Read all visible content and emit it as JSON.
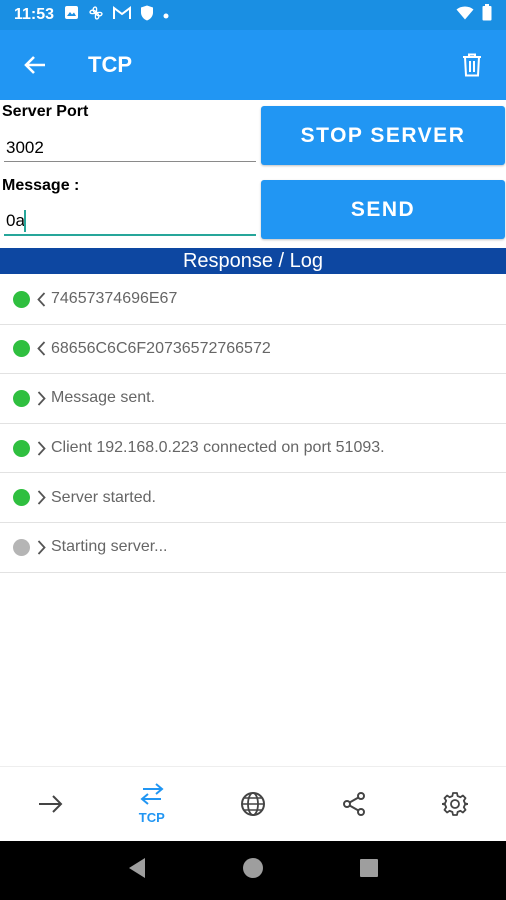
{
  "status_bar": {
    "time": "11:53",
    "icons": [
      "image-icon",
      "pinwheel-icon",
      "mail-icon",
      "shield-icon",
      "dot-icon"
    ],
    "right_icons": [
      "wifi-icon",
      "battery-icon"
    ]
  },
  "app_bar": {
    "title": "TCP",
    "color": "#2196f3"
  },
  "form": {
    "server_port_label": "Server Port",
    "server_port_value": "3002",
    "message_label": "Message :",
    "message_value": "0a"
  },
  "buttons": {
    "stop_server": "STOP SERVER",
    "send": "SEND"
  },
  "log": {
    "header": "Response / Log",
    "entries": [
      {
        "direction": "<",
        "text": "74657374696E67",
        "status_color": "#2fbf3f"
      },
      {
        "direction": "<",
        "text": "68656C6C6F20736572766572",
        "status_color": "#2fbf3f"
      },
      {
        "direction": ">",
        "text": "Message sent.",
        "status_color": "#2fbf3f"
      },
      {
        "direction": ">",
        "text": "Client 192.168.0.223 connected on port 51093.",
        "status_color": "#2fbf3f"
      },
      {
        "direction": ">",
        "text": "Server started.",
        "status_color": "#2fbf3f"
      },
      {
        "direction": ">",
        "text": "Starting server...",
        "status_color": "#b5b5b5"
      }
    ]
  },
  "bottom_nav": {
    "items": [
      {
        "icon": "arrow-right-icon",
        "label": ""
      },
      {
        "icon": "swap-arrows-icon",
        "label": "TCP",
        "active": true
      },
      {
        "icon": "globe-icon",
        "label": ""
      },
      {
        "icon": "share-icon",
        "label": ""
      },
      {
        "icon": "gear-icon",
        "label": ""
      }
    ]
  },
  "colors": {
    "primary": "#2196f3",
    "log_header": "#0d47a1",
    "active_green": "#2fbf3f",
    "inactive_gray": "#b5b5b5"
  }
}
